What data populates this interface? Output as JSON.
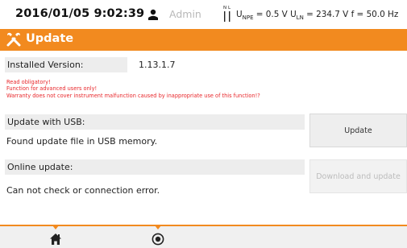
{
  "status": {
    "datetime": "2016/01/05 9:02:39",
    "user": "Admin",
    "measurement": {
      "u_npe_label": "U",
      "u_npe_sub": "NPE",
      "u_npe_value": " = 0.5 V ",
      "u_ln_label": "U",
      "u_ln_sub": "LN",
      "u_ln_value": " = 234.7 V ",
      "f_text": "f = 50.0 Hz"
    }
  },
  "title": "Update",
  "installed": {
    "label": "Installed Version:",
    "value": "1.13.1.7"
  },
  "warnings": [
    "Read obligatory!",
    "Function for advanced users only!",
    "Warranty does not cover instrument malfunction caused by inappropriate use of this function!?"
  ],
  "usb": {
    "label": "Update with USB:",
    "status": "Found update file in USB memory.",
    "button": "Update"
  },
  "online": {
    "label": "Online update:",
    "status": "Can not check or connection error.",
    "button": "Download and update"
  },
  "colors": {
    "accent": "#f28a1f",
    "warning": "#e8262a",
    "disabled_text": "#bcbcbc"
  },
  "icons": {
    "user": "person-icon",
    "nl": "nl-connector-icon",
    "title": "tools-icon",
    "nav_home": "home-icon",
    "nav_circle": "record-icon"
  }
}
